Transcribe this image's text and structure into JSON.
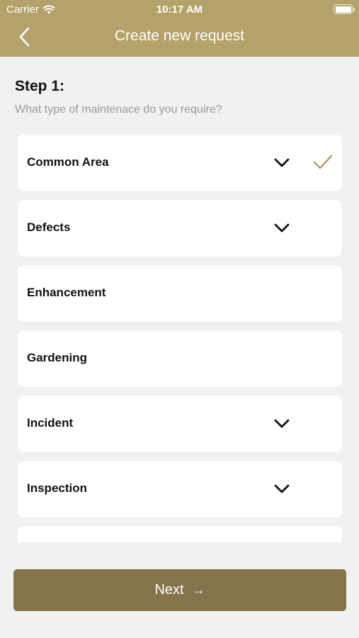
{
  "status_bar": {
    "carrier": "Carrier",
    "time": "10:17 AM",
    "wifi_icon": "wifi-icon",
    "battery_icon": "battery-icon"
  },
  "nav": {
    "title": "Create new request",
    "back_icon": "chevron-left-icon"
  },
  "step": {
    "title": "Step 1:",
    "subtitle": "What type of maintenace do you require?"
  },
  "categories": [
    {
      "label": "Common Area",
      "expandable": true,
      "selected": true
    },
    {
      "label": "Defects",
      "expandable": true,
      "selected": false
    },
    {
      "label": "Enhancement",
      "expandable": false,
      "selected": false
    },
    {
      "label": "Gardening",
      "expandable": false,
      "selected": false
    },
    {
      "label": "Incident",
      "expandable": true,
      "selected": false
    },
    {
      "label": "Inspection",
      "expandable": true,
      "selected": false
    },
    {
      "label": "",
      "expandable": false,
      "selected": false
    }
  ],
  "footer": {
    "next_label": "Next",
    "next_arrow": "→"
  },
  "colors": {
    "header": "#b4a26a",
    "accent_check": "#b4a26a",
    "button": "#85734b",
    "background": "#f1f1f1"
  }
}
